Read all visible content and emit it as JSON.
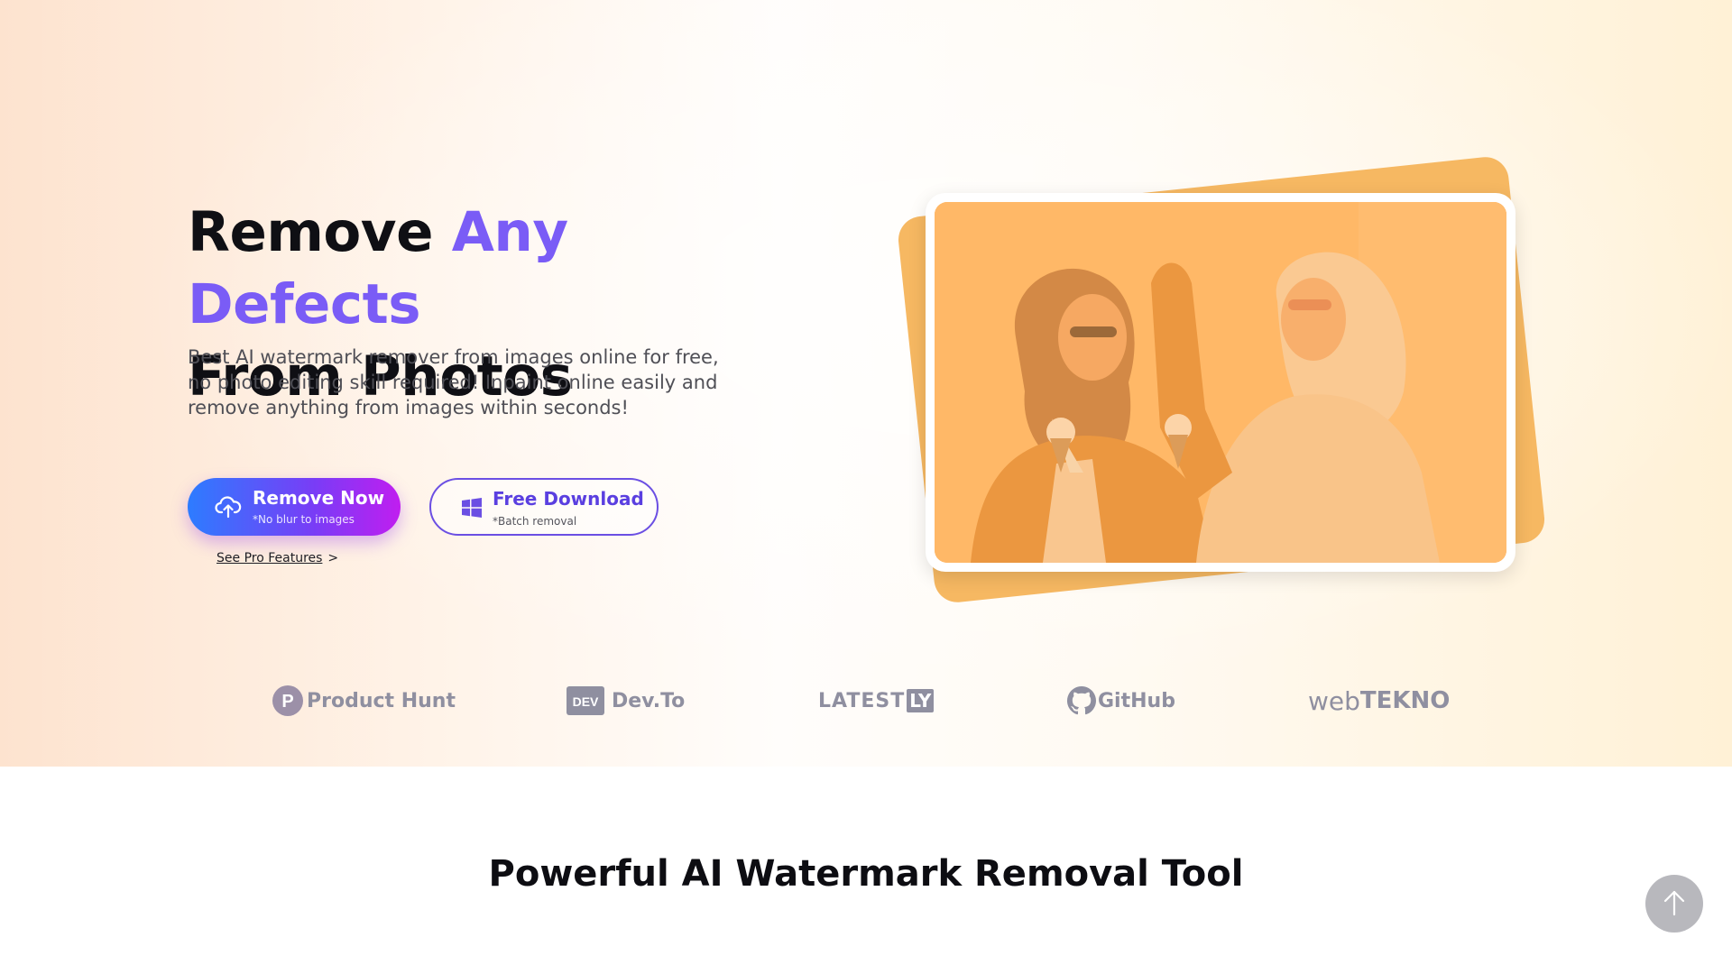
{
  "hero": {
    "headline_line1_plain": "Remove ",
    "headline_line1_accent": "Any Defects",
    "headline_line2": "From Photos",
    "subtext": "Best AI watermark remover from images online for free, no photo editing skill required! Inpaint online easily and remove anything from images within seconds!",
    "primary_button": {
      "label": "Remove Now",
      "sublabel": "*No blur to images",
      "icon": "cloud-upload-icon"
    },
    "secondary_button": {
      "label": "Free Download",
      "sublabel": "*Batch removal",
      "icon": "windows-icon"
    },
    "pro_link": {
      "label": "See Pro Features",
      "chevron": ">"
    },
    "image_alt": "two women laughing and holding ice cream cones"
  },
  "logos": [
    {
      "name": "Product Hunt",
      "badge": "P"
    },
    {
      "name": "Dev.To",
      "badge": "DEV"
    },
    {
      "name": "LATEST",
      "badge": "LY"
    },
    {
      "name": "GitHub"
    },
    {
      "name_plain": "web",
      "name_accent": "TEKNO"
    }
  ],
  "section": {
    "title": "Powerful AI Watermark Removal Tool"
  },
  "colors": {
    "accent_purple": "#7a5cf6",
    "button_gradient_start": "#2d7cff",
    "button_gradient_end": "#c01ef0",
    "photo_orange": "#f6b862",
    "logo_gray": "#8f8fa0"
  },
  "scroll_top": {
    "icon": "arrow-up-icon"
  }
}
